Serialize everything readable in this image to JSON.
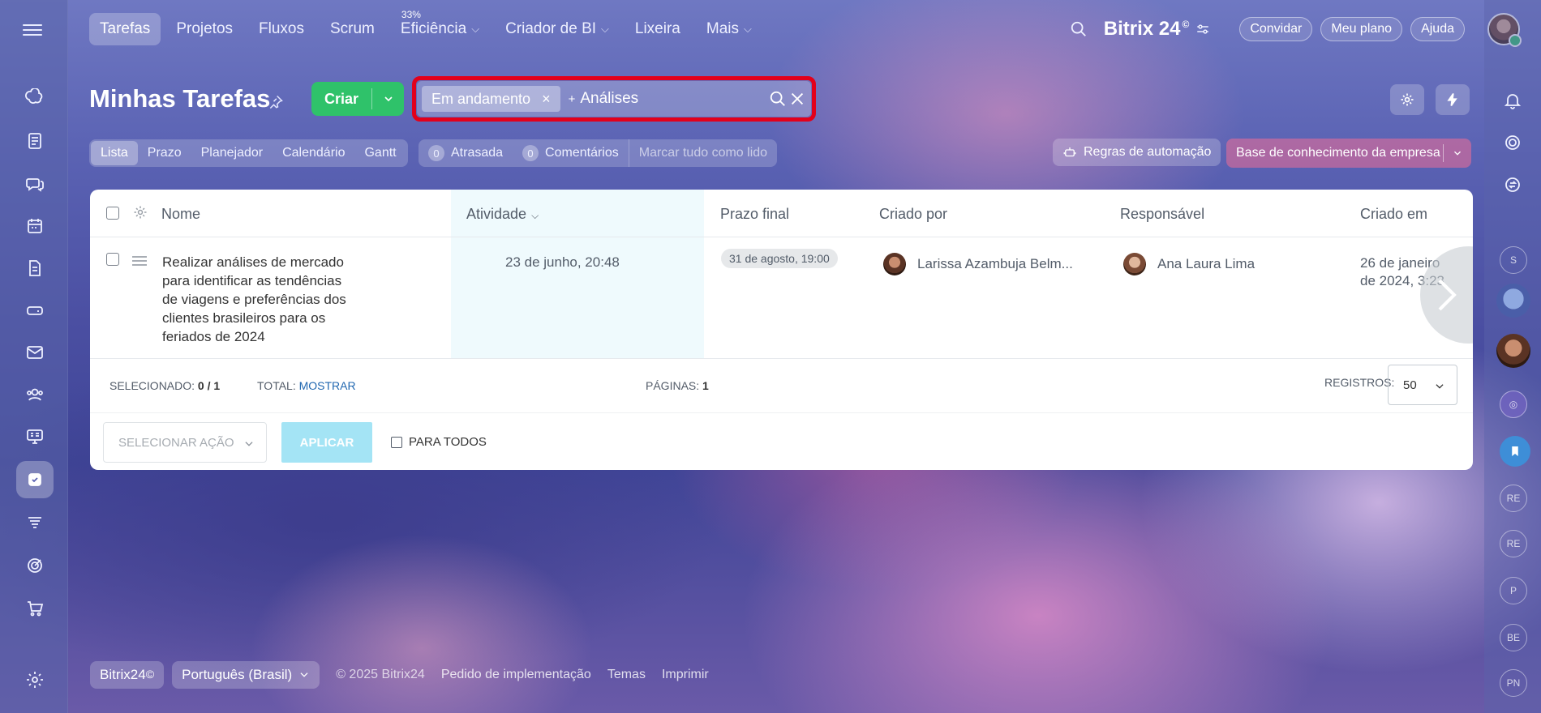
{
  "topnav": {
    "items": [
      {
        "label": "Tarefas",
        "active": true
      },
      {
        "label": "Projetos"
      },
      {
        "label": "Fluxos"
      },
      {
        "label": "Scrum"
      },
      {
        "label": "Eficiência",
        "badge": "33%",
        "dropdown": true
      },
      {
        "label": "Criador de BI",
        "dropdown": true
      },
      {
        "label": "Lixeira"
      },
      {
        "label": "Mais",
        "dropdown": true
      }
    ],
    "brand": "Bitrix 24",
    "brand_sup": "©",
    "invite": "Convidar",
    "my_plan": "Meu plano",
    "help": "Ajuda"
  },
  "page": {
    "title": "Minhas Tarefas",
    "create_label": "Criar"
  },
  "filter": {
    "chip": "Em andamento",
    "plus": "+",
    "query": "Análises"
  },
  "views": {
    "tabs": [
      "Lista",
      "Prazo",
      "Planejador",
      "Calendário",
      "Gantt"
    ],
    "active": "Lista"
  },
  "counters": {
    "overdue_count": "0",
    "overdue_label": "Atrasada",
    "comments_count": "0",
    "comments_label": "Comentários",
    "mark_all": "Marcar tudo como lido"
  },
  "automation_label": "Regras de automação",
  "knowledge_base_label": "Base de conhecimento da empresa",
  "grid": {
    "headers": {
      "name": "Nome",
      "activity": "Atividade",
      "deadline": "Prazo final",
      "created_by": "Criado por",
      "responsible": "Responsável",
      "created_at": "Criado em"
    },
    "rows": [
      {
        "name": "Realizar análises de mercado para identificar as tendências de viagens e preferências dos clientes brasileiros para os feriados de 2024",
        "activity": "23 de junho, 20:48",
        "deadline": "31 de agosto, 19:00",
        "created_by": "Larissa Azambuja Belm...",
        "responsible": "Ana Laura Lima",
        "created_at": "26 de janeiro de 2024, 3:23"
      }
    ],
    "footer": {
      "selected_label": "SELECIONADO:",
      "selected_value": "0 / 1",
      "total_label": "TOTAL:",
      "total_link": "MOSTRAR",
      "pages_label": "PÁGINAS:",
      "pages_value": "1",
      "records_label": "REGISTROS:",
      "records_value": "50"
    },
    "actions": {
      "select_placeholder": "SELECIONAR AÇÃO",
      "apply": "APLICAR",
      "for_all": "PARA TODOS"
    }
  },
  "right_rail": {
    "initials": [
      "S",
      "RE",
      "RE",
      "P",
      "BE",
      "PN"
    ]
  },
  "footer": {
    "brand": "Bitrix24",
    "brand_sup": "©",
    "language": "Português (Brasil)",
    "copyright": "© 2025 Bitrix24",
    "links": [
      "Pedido de implementação",
      "Temas",
      "Imprimir"
    ]
  },
  "colors": {
    "create_green": "#2fc26a",
    "highlight_red": "#e3001b",
    "apply_disabled": "#a4e4f5",
    "link_blue": "#2067b0"
  }
}
